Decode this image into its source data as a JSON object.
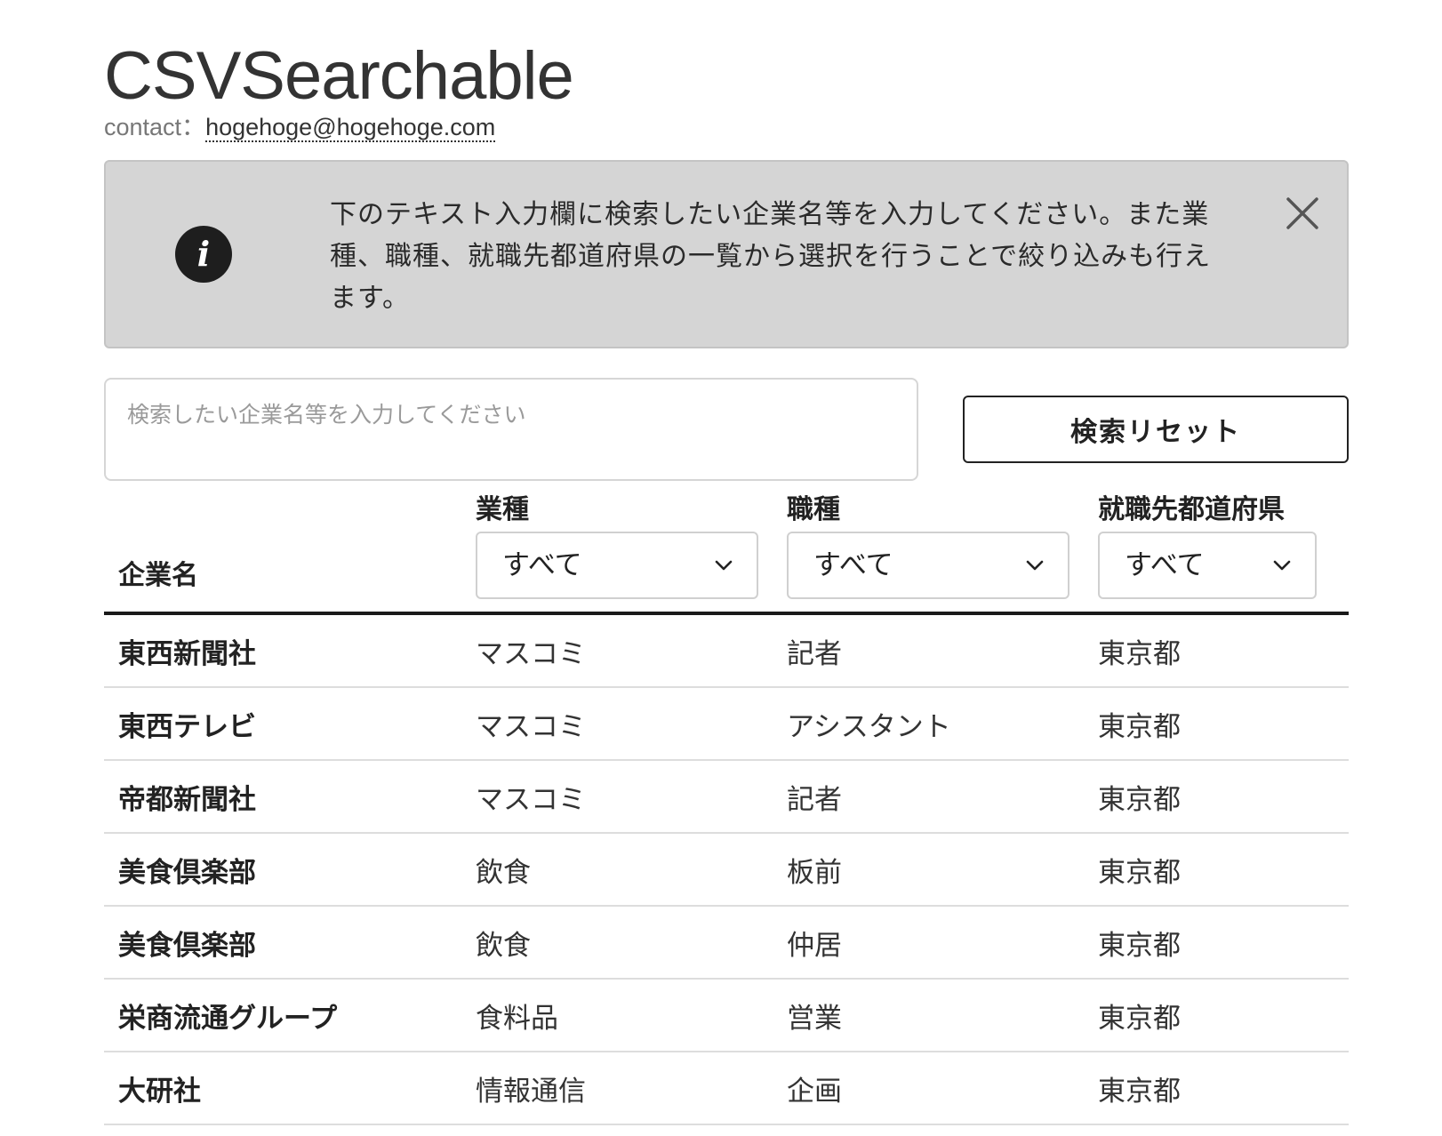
{
  "header": {
    "title": "CSVSearchable",
    "contact_label": "contact：",
    "contact_email": "hogehoge@hogehoge.com"
  },
  "alert": {
    "icon": "info-icon",
    "message": "下のテキスト入力欄に検索したい企業名等を入力してください。また業種、職種、就職先都道府県の一覧から選択を行うことで絞り込みも行えます。",
    "close_icon": "close-icon",
    "background": "#d5d5d5"
  },
  "search": {
    "placeholder": "検索したい企業名等を入力してください",
    "value": "",
    "reset_label": "検索リセット"
  },
  "table": {
    "columns": {
      "company": "企業名",
      "industry": "業種",
      "occupation": "職種",
      "prefecture": "就職先都道府県"
    },
    "filters": {
      "industry": "すべて",
      "occupation": "すべて",
      "prefecture": "すべて"
    },
    "rows": [
      {
        "company": "東西新聞社",
        "industry": "マスコミ",
        "occupation": "記者",
        "prefecture": "東京都"
      },
      {
        "company": "東西テレビ",
        "industry": "マスコミ",
        "occupation": "アシスタント",
        "prefecture": "東京都"
      },
      {
        "company": "帝都新聞社",
        "industry": "マスコミ",
        "occupation": "記者",
        "prefecture": "東京都"
      },
      {
        "company": "美食倶楽部",
        "industry": "飲食",
        "occupation": "板前",
        "prefecture": "東京都"
      },
      {
        "company": "美食倶楽部",
        "industry": "飲食",
        "occupation": "仲居",
        "prefecture": "東京都"
      },
      {
        "company": "栄商流通グループ",
        "industry": "食料品",
        "occupation": "営業",
        "prefecture": "東京都"
      },
      {
        "company": "大研社",
        "industry": "情報通信",
        "occupation": "企画",
        "prefecture": "東京都"
      }
    ]
  }
}
